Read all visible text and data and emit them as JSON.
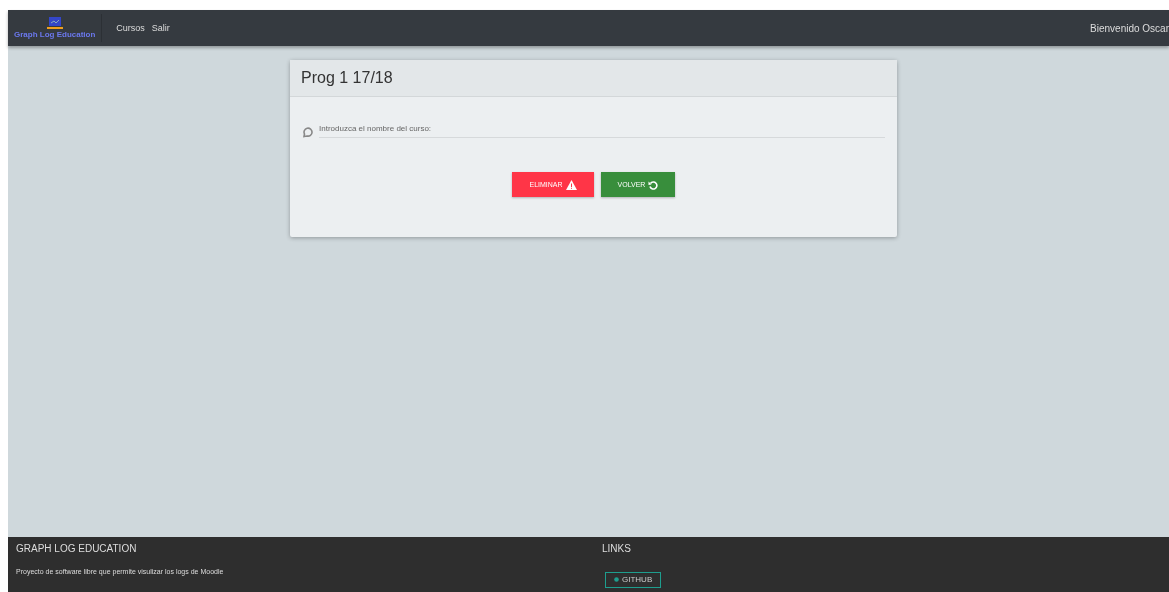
{
  "navbar": {
    "logo_text": "Graph Log Education",
    "links": [
      "Cursos",
      "Salir"
    ],
    "welcome": "Bienvenido Oscar"
  },
  "card": {
    "title": "Prog 1 17/18",
    "field": {
      "placeholder": "Introduzca el nombre del curso:"
    },
    "buttons": [
      {
        "label": "ELIMINAR",
        "kind": "danger"
      },
      {
        "label": "VOLVER",
        "kind": "back"
      }
    ]
  },
  "footer": {
    "title": "GRAPH LOG EDUCATION",
    "description": "Proyecto de software libre que permite visulizar los logs de Moodle",
    "links_title": "LINKS",
    "links": [
      "GITHUB"
    ]
  }
}
